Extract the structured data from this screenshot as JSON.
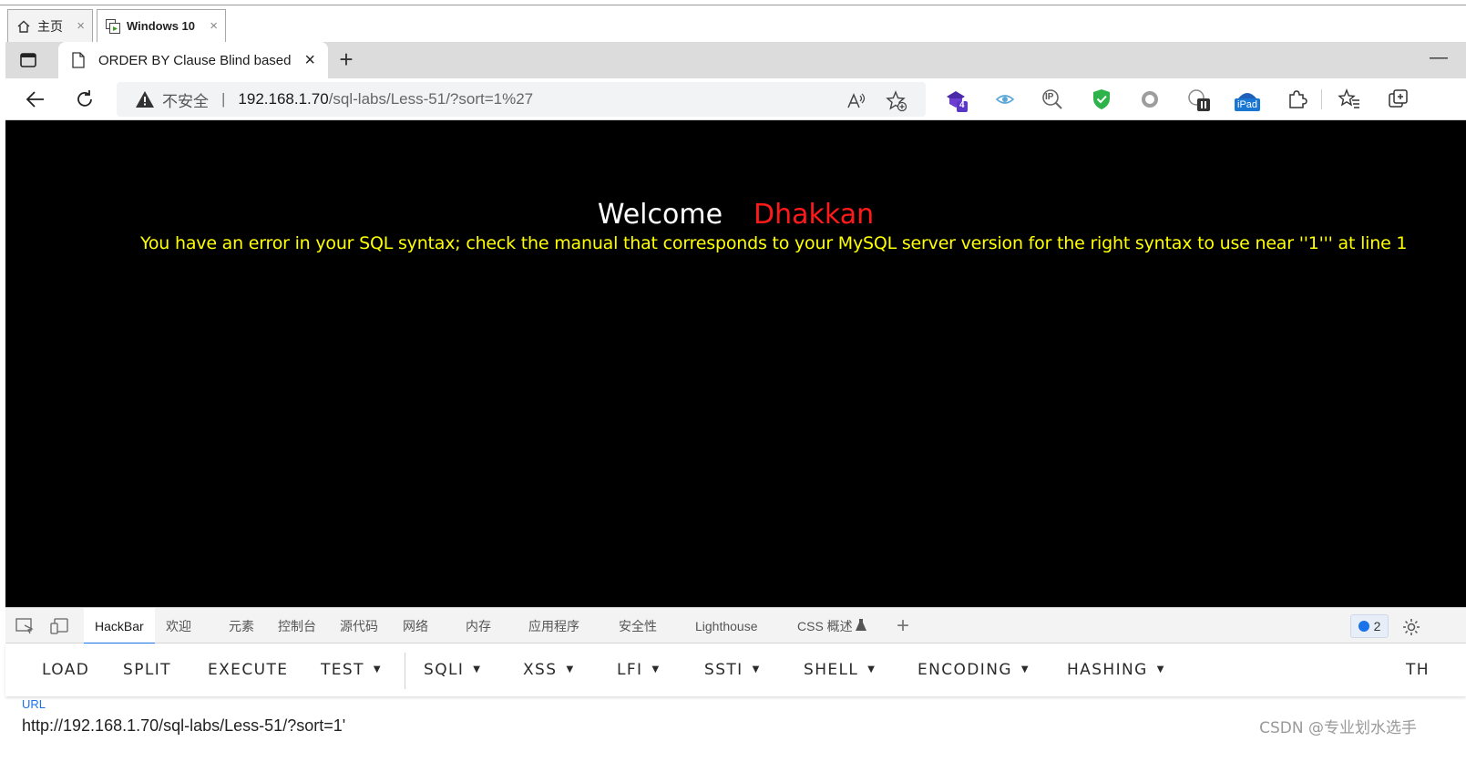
{
  "vm_tabs": [
    {
      "label": "主页",
      "icon": "home-icon",
      "close": "×"
    },
    {
      "label": "Windows 10",
      "icon": "vm-window-icon",
      "close": "×"
    }
  ],
  "browser": {
    "tab_title": "ORDER BY Clause Blind based",
    "tab_close": "×",
    "new_tab": "+",
    "minimize": "—",
    "insecure_label": "不安全",
    "separator": "|",
    "url_host": "192.168.1.70",
    "url_path": "/sql-labs/Less-51/?sort=1%27",
    "extensions": [
      {
        "name": "ext-purple-icon",
        "badge": "4"
      },
      {
        "name": "ext-eye-icon"
      },
      {
        "name": "ext-ip-icon",
        "text": "IP"
      },
      {
        "name": "ext-shield-icon"
      },
      {
        "name": "ext-circle-icon"
      },
      {
        "name": "ext-pause-icon"
      },
      {
        "name": "ext-ipad-icon",
        "text": "iPad"
      }
    ]
  },
  "page": {
    "welcome": "Welcome",
    "user": "Dhakkan",
    "error": "You have an error in your SQL syntax; check the manual that corresponds to your MySQL server version for the right syntax to use near ''1''' at line 1",
    "colors": {
      "background": "#000000",
      "welcome": "#ffffff",
      "user": "#ff1a1a",
      "error": "#ffff00"
    }
  },
  "devtools": {
    "tabs": [
      "HackBar",
      "欢迎",
      "元素",
      "控制台",
      "源代码",
      "网络",
      "内存",
      "应用程序",
      "安全性",
      "Lighthouse",
      "CSS 概述"
    ],
    "add": "+",
    "issues_count": "2"
  },
  "hackbar": {
    "buttons": [
      {
        "label": "LOAD"
      },
      {
        "label": "SPLIT"
      },
      {
        "label": "EXECUTE"
      },
      {
        "label": "TEST",
        "dropdown": true
      },
      {
        "label": "SQLI",
        "dropdown": true
      },
      {
        "label": "XSS",
        "dropdown": true
      },
      {
        "label": "LFI",
        "dropdown": true
      },
      {
        "label": "SSTI",
        "dropdown": true
      },
      {
        "label": "SHELL",
        "dropdown": true
      },
      {
        "label": "ENCODING",
        "dropdown": true
      },
      {
        "label": "HASHING",
        "dropdown": true
      },
      {
        "label": "TH"
      }
    ],
    "caret": "▼",
    "url_label": "URL",
    "url_value": "http://192.168.1.70/sql-labs/Less-51/?sort=1'"
  },
  "watermark": "CSDN @专业划水选手"
}
